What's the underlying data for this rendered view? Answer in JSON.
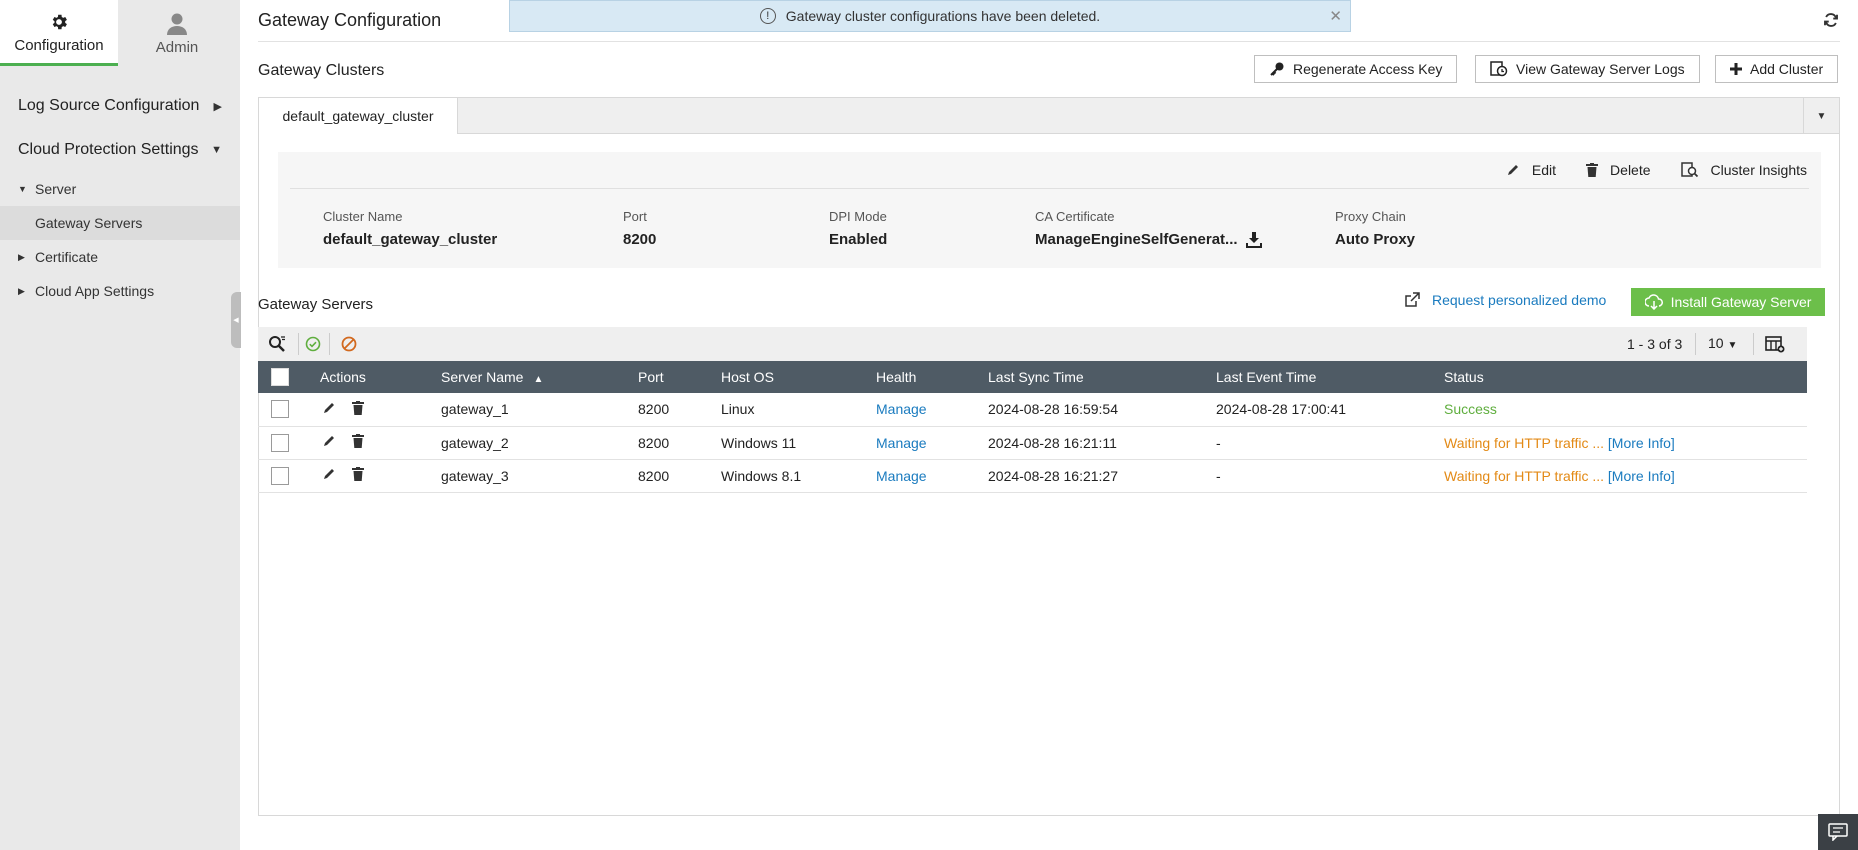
{
  "sidebar": {
    "top_tabs": [
      {
        "label": "Configuration",
        "icon": "gear-icon",
        "active": true
      },
      {
        "label": "Admin",
        "icon": "user-icon",
        "active": false
      }
    ],
    "nav": {
      "log_source": "Log Source Configuration",
      "cloud_protection": "Cloud Protection Settings",
      "server": "Server",
      "gateway_servers": "Gateway Servers",
      "certificate": "Certificate",
      "cloud_app_settings": "Cloud App Settings"
    }
  },
  "header": {
    "title": "Gateway Configuration",
    "toast": "Gateway cluster configurations have been deleted."
  },
  "clusters": {
    "title": "Gateway Clusters",
    "buttons": {
      "regenerate": "Regenerate Access Key",
      "view_logs": "View Gateway Server Logs",
      "add_cluster": "Add Cluster"
    },
    "active_tab": "default_gateway_cluster",
    "actions": {
      "edit": "Edit",
      "delete": "Delete",
      "insights": "Cluster Insights"
    },
    "details": {
      "cluster_name_label": "Cluster Name",
      "cluster_name": "default_gateway_cluster",
      "port_label": "Port",
      "port": "8200",
      "dpi_label": "DPI Mode",
      "dpi": "Enabled",
      "ca_label": "CA Certificate",
      "ca": "ManageEngineSelfGenerat...",
      "proxy_label": "Proxy Chain",
      "proxy": "Auto Proxy"
    }
  },
  "gateway_servers": {
    "title": "Gateway Servers",
    "demo_link": "Request personalized demo",
    "install_button": "Install Gateway Server",
    "pager": "1 - 3 of 3",
    "page_size": "10",
    "columns": {
      "actions": "Actions",
      "server_name": "Server Name",
      "port": "Port",
      "host_os": "Host OS",
      "health": "Health",
      "last_sync": "Last Sync Time",
      "last_event": "Last Event Time",
      "status": "Status"
    },
    "rows": [
      {
        "server_name": "gateway_1",
        "port": "8200",
        "host_os": "Linux",
        "health": "Manage",
        "last_sync": "2024-08-28 16:59:54",
        "last_event": "2024-08-28 17:00:41",
        "status": "Success",
        "more": ""
      },
      {
        "server_name": "gateway_2",
        "port": "8200",
        "host_os": "Windows 11",
        "health": "Manage",
        "last_sync": "2024-08-28 16:21:11",
        "last_event": "-",
        "status": "Waiting for HTTP traffic ...",
        "more": "[More Info]"
      },
      {
        "server_name": "gateway_3",
        "port": "8200",
        "host_os": "Windows 8.1",
        "health": "Manage",
        "last_sync": "2024-08-28 16:21:27",
        "last_event": "-",
        "status": "Waiting for HTTP traffic ...",
        "more": "[More Info]"
      }
    ]
  },
  "colors": {
    "accent_green": "#6cbf4a",
    "link_blue": "#1a7bbf",
    "warning_orange": "#e38a16",
    "header_dark": "#4f5b65"
  }
}
